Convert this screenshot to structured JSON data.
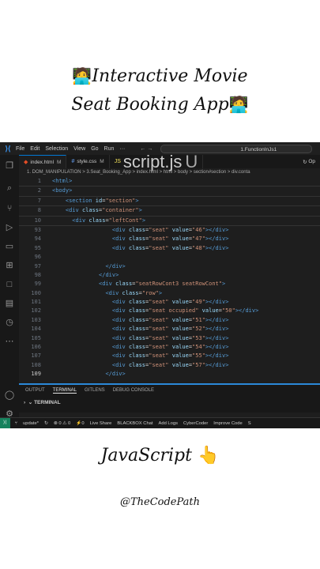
{
  "title": {
    "line1": "Interactive Movie",
    "line2": "Seat Booking App",
    "emoji": "🧑‍💻"
  },
  "vscode": {
    "menu": [
      "File",
      "Edit",
      "Selection",
      "View",
      "Go",
      "Run",
      "···"
    ],
    "nav_arrows": "←  →",
    "command_center": "1.FunctionInJs1",
    "tabs": [
      {
        "icon": "html-file-icon",
        "name": "index.html",
        "mark": "M"
      },
      {
        "icon": "css-file-icon",
        "name": "style.css",
        "mark": "M"
      },
      {
        "icon": "js-file-icon",
        "name": "script.js",
        "mark": "U"
      }
    ],
    "open_label": "Op",
    "breadcrumb": "1. DOM_MANIPULATION  >  3.Seat_Booking_App  >  index.html  >  html  >  body  >  section#section  >  div.conta",
    "lines": [
      {
        "n": "1",
        "html": "<span class='tg'>&lt;html&gt;</span>"
      },
      {
        "n": "2",
        "html": "<span class='tg'>&lt;body&gt;</span>"
      },
      {
        "n": "7",
        "html": "    <span class='tg'>&lt;section</span> <span class='at'>id</span>=<span class='st'>\"section\"</span><span class='tg'>&gt;</span>"
      },
      {
        "n": "8",
        "html": "    <span class='tg'>&lt;div</span> <span class='at'>class</span>=<span class='st'>\"container\"</span><span class='tg'>&gt;</span>"
      },
      {
        "n": "10",
        "html": "      <span class='tg'>&lt;div</span> <span class='at'>class</span>=<span class='st'>\"leftCont\"</span><span class='tg'>&gt;</span>"
      },
      {
        "n": "93",
        "html": "                  <span class='tg'>&lt;div</span> <span class='at'>class</span>=<span class='st'>\"seat\"</span> <span class='at'>value</span>=<span class='st'>\"46\"</span><span class='tg'>&gt;&lt;/div&gt;</span>"
      },
      {
        "n": "94",
        "html": "                  <span class='tg'>&lt;div</span> <span class='at'>class</span>=<span class='st'>\"seat\"</span> <span class='at'>value</span>=<span class='st'>\"47\"</span><span class='tg'>&gt;&lt;/div&gt;</span>"
      },
      {
        "n": "95",
        "html": "                  <span class='tg'>&lt;div</span> <span class='at'>class</span>=<span class='st'>\"seat\"</span> <span class='at'>value</span>=<span class='st'>\"48\"</span><span class='tg'>&gt;&lt;/div&gt;</span>"
      },
      {
        "n": "96",
        "html": ""
      },
      {
        "n": "97",
        "html": "                <span class='tg'>&lt;/div&gt;</span>"
      },
      {
        "n": "98",
        "html": "              <span class='tg'>&lt;/div&gt;</span>"
      },
      {
        "n": "99",
        "html": "              <span class='tg'>&lt;div</span> <span class='at'>class</span>=<span class='st'>\"seatRowCont3 seatRowCont\"</span><span class='tg'>&gt;</span>"
      },
      {
        "n": "100",
        "html": "                <span class='tg'>&lt;div</span> <span class='at'>class</span>=<span class='st'>\"row\"</span><span class='tg'>&gt;</span>"
      },
      {
        "n": "101",
        "html": "                  <span class='tg'>&lt;div</span> <span class='at'>class</span>=<span class='st'>\"seat\"</span> <span class='at'>value</span>=<span class='st'>\"49\"</span><span class='tg'>&gt;&lt;/div&gt;</span>"
      },
      {
        "n": "102",
        "html": "                  <span class='tg'>&lt;div</span> <span class='at'>class</span>=<span class='st'>\"seat occupied\"</span> <span class='at'>value</span>=<span class='st'>\"50\"</span><span class='tg'>&gt;&lt;/div&gt;</span>"
      },
      {
        "n": "103",
        "html": "                  <span class='tg'>&lt;div</span> <span class='at'>class</span>=<span class='st'>\"seat\"</span> <span class='at'>value</span>=<span class='st'>\"51\"</span><span class='tg'>&gt;&lt;/div&gt;</span>"
      },
      {
        "n": "104",
        "html": "                  <span class='tg'>&lt;div</span> <span class='at'>class</span>=<span class='st'>\"seat\"</span> <span class='at'>value</span>=<span class='st'>\"52\"</span><span class='tg'>&gt;&lt;/div&gt;</span>"
      },
      {
        "n": "105",
        "html": "                  <span class='tg'>&lt;div</span> <span class='at'>class</span>=<span class='st'>\"seat\"</span> <span class='at'>value</span>=<span class='st'>\"53\"</span><span class='tg'>&gt;&lt;/div&gt;</span>"
      },
      {
        "n": "106",
        "html": "                  <span class='tg'>&lt;div</span> <span class='at'>class</span>=<span class='st'>\"seat\"</span> <span class='at'>value</span>=<span class='st'>\"54\"</span><span class='tg'>&gt;&lt;/div&gt;</span>"
      },
      {
        "n": "107",
        "html": "                  <span class='tg'>&lt;div</span> <span class='at'>class</span>=<span class='st'>\"seat\"</span> <span class='at'>value</span>=<span class='st'>\"55\"</span><span class='tg'>&gt;&lt;/div&gt;</span>"
      },
      {
        "n": "108",
        "html": "                  <span class='tg'>&lt;div</span> <span class='at'>class</span>=<span class='st'>\"seat\"</span> <span class='at'>value</span>=<span class='st'>\"57\"</span><span class='tg'>&gt;&lt;/div&gt;</span>"
      },
      {
        "n": "109",
        "html": "                <span class='tg'>&lt;/div&gt;</span>"
      }
    ],
    "panel_tabs": [
      "OUTPUT",
      "TERMINAL",
      "GITLENS",
      "DEBUG CONSOLE"
    ],
    "terminal_label": "TERMINAL",
    "status": [
      "update*",
      "↻",
      "⊗ 0 ⚠ 0",
      "⚡0",
      "Live Share",
      "BLACKBOX Chat",
      "Add Logs",
      "CyberCoder",
      "Improve Code",
      "S"
    ]
  },
  "caption": {
    "language": "JavaScript",
    "pointer": "👆",
    "handle": "@TheCodePath"
  }
}
